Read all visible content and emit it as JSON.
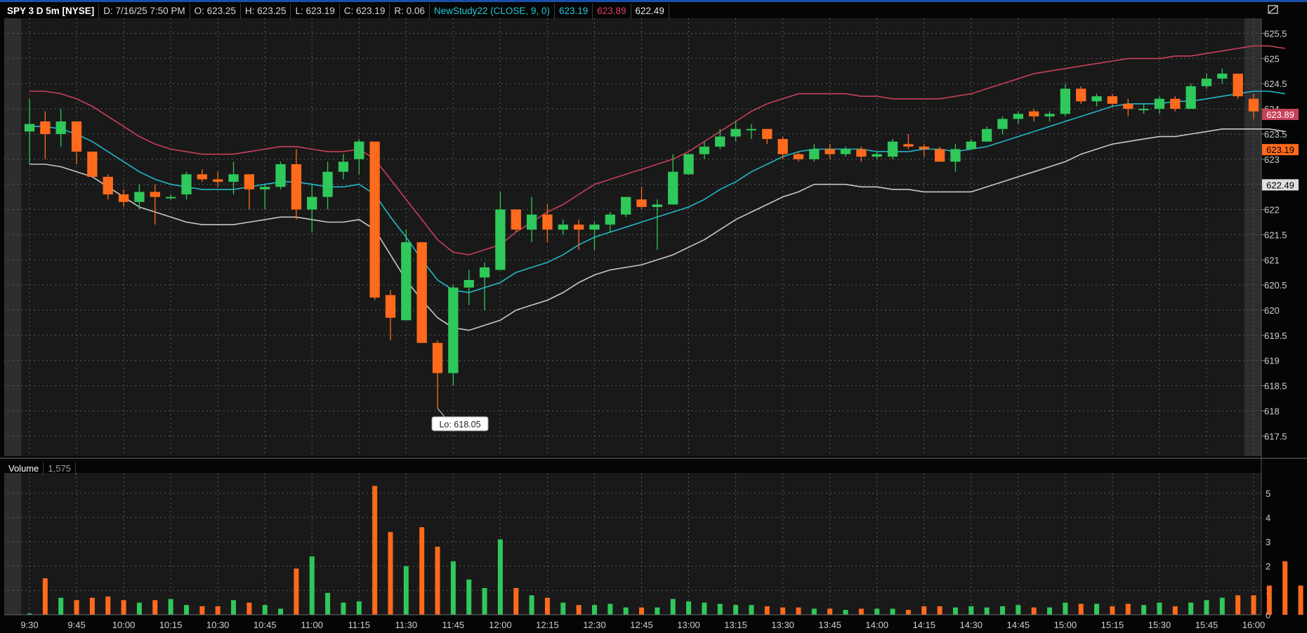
{
  "header": {
    "symbol": "SPY 3 D 5m [NYSE]",
    "date": "D: 7/16/25 7:50 PM",
    "open": "O: 623.25",
    "high": "H: 623.25",
    "low": "L: 623.19",
    "close": "C: 623.19",
    "range": "R: 0.06",
    "study": "NewStudy22 (CLOSE, 9, 0)",
    "study_v1": "623.19",
    "study_v2": "623.89",
    "study_v3": "622.49"
  },
  "volume_header": {
    "label": "Volume",
    "value": "1,575"
  },
  "icons": {
    "restore": "restore-window-icon"
  },
  "colors": {
    "up": "#2fc85a",
    "down": "#ff6a1c",
    "mid_line": "#21b8c8",
    "upper_band": "#c8405a",
    "lower_band": "#c8c8c8",
    "grid": "#5a5a5a",
    "background": "#191919"
  },
  "chart_data": [
    {
      "type": "candlestick",
      "title": "SPY 3 D 5m [NYSE]",
      "ylim": [
        617.1,
        625.8
      ],
      "y_ticks": [
        "617.5",
        "618",
        "618.5",
        "619",
        "619.5",
        "620",
        "620.5",
        "621",
        "621.5",
        "622",
        "622.5",
        "623",
        "623.5",
        "624",
        "624.5",
        "625",
        "625.5"
      ],
      "x_ticks": [
        "9:30",
        "9:45",
        "10:00",
        "10:15",
        "10:30",
        "10:45",
        "11:00",
        "11:15",
        "11:30",
        "11:45",
        "12:00",
        "12:15",
        "12:30",
        "12:45",
        "13:00",
        "13:15",
        "13:30",
        "13:45",
        "14:00",
        "14:15",
        "14:30",
        "14:45",
        "15:00",
        "15:15",
        "15:30",
        "15:45",
        "16:00"
      ],
      "price_labels": {
        "upper": "623.89",
        "last": "623.19",
        "lower": "622.49"
      },
      "annotation": "Lo: 618.05",
      "candles": [
        {
          "t": "9:30",
          "o": 623.55,
          "h": 624.2,
          "l": 622.9,
          "c": 623.7
        },
        {
          "t": "9:35",
          "o": 623.75,
          "h": 623.95,
          "l": 623.0,
          "c": 623.5
        },
        {
          "t": "9:40",
          "o": 623.5,
          "h": 624.0,
          "l": 623.25,
          "c": 623.75
        },
        {
          "t": "9:45",
          "o": 623.75,
          "h": 623.75,
          "l": 622.9,
          "c": 623.15
        },
        {
          "t": "9:50",
          "o": 623.15,
          "h": 623.15,
          "l": 622.65,
          "c": 622.65
        },
        {
          "t": "9:55",
          "o": 622.65,
          "h": 622.7,
          "l": 622.2,
          "c": 622.3
        },
        {
          "t": "10:00",
          "o": 622.3,
          "h": 622.4,
          "l": 622.05,
          "c": 622.15
        },
        {
          "t": "10:05",
          "o": 622.15,
          "h": 622.5,
          "l": 622.0,
          "c": 622.35
        },
        {
          "t": "10:10",
          "o": 622.35,
          "h": 622.5,
          "l": 621.7,
          "c": 622.25
        },
        {
          "t": "10:15",
          "o": 622.25,
          "h": 622.3,
          "l": 622.2,
          "c": 622.25
        },
        {
          "t": "10:20",
          "o": 622.3,
          "h": 622.75,
          "l": 622.2,
          "c": 622.7
        },
        {
          "t": "10:25",
          "o": 622.7,
          "h": 622.8,
          "l": 622.55,
          "c": 622.6
        },
        {
          "t": "10:30",
          "o": 622.6,
          "h": 622.75,
          "l": 622.45,
          "c": 622.55
        },
        {
          "t": "10:35",
          "o": 622.55,
          "h": 622.95,
          "l": 622.3,
          "c": 622.7
        },
        {
          "t": "10:40",
          "o": 622.7,
          "h": 622.7,
          "l": 622.0,
          "c": 622.4
        },
        {
          "t": "10:45",
          "o": 622.4,
          "h": 622.5,
          "l": 622.0,
          "c": 622.45
        },
        {
          "t": "10:50",
          "o": 622.45,
          "h": 622.95,
          "l": 622.4,
          "c": 622.9
        },
        {
          "t": "10:55",
          "o": 622.9,
          "h": 623.2,
          "l": 621.8,
          "c": 622.0
        },
        {
          "t": "11:00",
          "o": 622.0,
          "h": 622.5,
          "l": 621.55,
          "c": 622.25
        },
        {
          "t": "11:05",
          "o": 622.25,
          "h": 622.95,
          "l": 622.0,
          "c": 622.75
        },
        {
          "t": "11:10",
          "o": 622.75,
          "h": 623.1,
          "l": 622.6,
          "c": 622.95
        },
        {
          "t": "11:15",
          "o": 623.0,
          "h": 623.4,
          "l": 622.7,
          "c": 623.35
        },
        {
          "t": "11:20",
          "o": 623.35,
          "h": 623.35,
          "l": 620.2,
          "c": 620.25
        },
        {
          "t": "11:25",
          "o": 620.3,
          "h": 620.4,
          "l": 619.4,
          "c": 619.85
        },
        {
          "t": "11:30",
          "o": 619.8,
          "h": 621.6,
          "l": 619.8,
          "c": 621.35
        },
        {
          "t": "11:35",
          "o": 621.35,
          "h": 621.35,
          "l": 619.35,
          "c": 619.35
        },
        {
          "t": "11:40",
          "o": 619.35,
          "h": 619.4,
          "l": 618.05,
          "c": 618.75
        },
        {
          "t": "11:45",
          "o": 618.75,
          "h": 620.5,
          "l": 618.5,
          "c": 620.45
        },
        {
          "t": "11:50",
          "o": 620.45,
          "h": 620.8,
          "l": 620.1,
          "c": 620.6
        },
        {
          "t": "11:55",
          "o": 620.65,
          "h": 620.95,
          "l": 620.0,
          "c": 620.85
        },
        {
          "t": "12:00",
          "o": 620.8,
          "h": 622.35,
          "l": 620.8,
          "c": 622.0
        },
        {
          "t": "12:05",
          "o": 622.0,
          "h": 622.0,
          "l": 621.55,
          "c": 621.6
        },
        {
          "t": "12:10",
          "o": 621.6,
          "h": 622.25,
          "l": 621.35,
          "c": 621.9
        },
        {
          "t": "12:15",
          "o": 621.9,
          "h": 622.1,
          "l": 621.35,
          "c": 621.6
        },
        {
          "t": "12:20",
          "o": 621.6,
          "h": 621.8,
          "l": 621.5,
          "c": 621.7
        },
        {
          "t": "12:25",
          "o": 621.7,
          "h": 621.8,
          "l": 621.2,
          "c": 621.6
        },
        {
          "t": "12:30",
          "o": 621.6,
          "h": 621.75,
          "l": 621.2,
          "c": 621.7
        },
        {
          "t": "12:35",
          "o": 621.7,
          "h": 621.95,
          "l": 621.55,
          "c": 621.9
        },
        {
          "t": "12:40",
          "o": 621.9,
          "h": 622.25,
          "l": 621.85,
          "c": 622.25
        },
        {
          "t": "12:45",
          "o": 622.2,
          "h": 622.45,
          "l": 622.0,
          "c": 622.05
        },
        {
          "t": "12:50",
          "o": 622.05,
          "h": 622.2,
          "l": 621.2,
          "c": 622.1
        },
        {
          "t": "12:55",
          "o": 622.1,
          "h": 623.1,
          "l": 622.1,
          "c": 622.75
        },
        {
          "t": "13:00",
          "o": 622.7,
          "h": 623.1,
          "l": 622.7,
          "c": 623.1
        },
        {
          "t": "13:05",
          "o": 623.1,
          "h": 623.35,
          "l": 623.0,
          "c": 623.25
        },
        {
          "t": "13:10",
          "o": 623.25,
          "h": 623.6,
          "l": 623.2,
          "c": 623.45
        },
        {
          "t": "13:15",
          "o": 623.45,
          "h": 623.75,
          "l": 623.35,
          "c": 623.6
        },
        {
          "t": "13:20",
          "o": 623.6,
          "h": 623.7,
          "l": 623.4,
          "c": 623.6
        },
        {
          "t": "13:25",
          "o": 623.6,
          "h": 623.6,
          "l": 623.3,
          "c": 623.4
        },
        {
          "t": "13:30",
          "o": 623.4,
          "h": 623.45,
          "l": 623.0,
          "c": 623.1
        },
        {
          "t": "13:35",
          "o": 623.1,
          "h": 623.15,
          "l": 622.95,
          "c": 623.0
        },
        {
          "t": "13:40",
          "o": 623.0,
          "h": 623.3,
          "l": 622.95,
          "c": 623.2
        },
        {
          "t": "13:45",
          "o": 623.2,
          "h": 623.3,
          "l": 623.0,
          "c": 623.1
        },
        {
          "t": "13:50",
          "o": 623.1,
          "h": 623.25,
          "l": 623.05,
          "c": 623.2
        },
        {
          "t": "13:55",
          "o": 623.2,
          "h": 623.25,
          "l": 622.95,
          "c": 623.05
        },
        {
          "t": "14:00",
          "o": 623.05,
          "h": 623.15,
          "l": 623.0,
          "c": 623.1
        },
        {
          "t": "14:05",
          "o": 623.05,
          "h": 623.4,
          "l": 623.0,
          "c": 623.35
        },
        {
          "t": "14:10",
          "o": 623.3,
          "h": 623.5,
          "l": 623.2,
          "c": 623.25
        },
        {
          "t": "14:15",
          "o": 623.25,
          "h": 623.3,
          "l": 623.05,
          "c": 623.2
        },
        {
          "t": "14:20",
          "o": 623.2,
          "h": 623.25,
          "l": 622.95,
          "c": 622.95
        },
        {
          "t": "14:25",
          "o": 622.95,
          "h": 623.3,
          "l": 622.75,
          "c": 623.2
        },
        {
          "t": "14:30",
          "o": 623.2,
          "h": 623.4,
          "l": 623.2,
          "c": 623.35
        },
        {
          "t": "14:35",
          "o": 623.35,
          "h": 623.65,
          "l": 623.35,
          "c": 623.6
        },
        {
          "t": "14:40",
          "o": 623.6,
          "h": 623.85,
          "l": 623.5,
          "c": 623.8
        },
        {
          "t": "14:45",
          "o": 623.8,
          "h": 623.95,
          "l": 623.7,
          "c": 623.9
        },
        {
          "t": "14:50",
          "o": 623.95,
          "h": 624.0,
          "l": 623.75,
          "c": 623.85
        },
        {
          "t": "14:55",
          "o": 623.85,
          "h": 623.95,
          "l": 623.75,
          "c": 623.9
        },
        {
          "t": "15:00",
          "o": 623.9,
          "h": 624.5,
          "l": 623.85,
          "c": 624.4
        },
        {
          "t": "15:05",
          "o": 624.4,
          "h": 624.45,
          "l": 624.1,
          "c": 624.15
        },
        {
          "t": "15:10",
          "o": 624.15,
          "h": 624.3,
          "l": 624.05,
          "c": 624.25
        },
        {
          "t": "15:15",
          "o": 624.25,
          "h": 624.3,
          "l": 624.05,
          "c": 624.1
        },
        {
          "t": "15:20",
          "o": 624.1,
          "h": 624.2,
          "l": 623.85,
          "c": 624.0
        },
        {
          "t": "15:25",
          "o": 624.0,
          "h": 624.1,
          "l": 623.9,
          "c": 624.0
        },
        {
          "t": "15:30",
          "o": 624.0,
          "h": 624.25,
          "l": 623.9,
          "c": 624.2
        },
        {
          "t": "15:35",
          "o": 624.2,
          "h": 624.25,
          "l": 623.95,
          "c": 624.0
        },
        {
          "t": "15:40",
          "o": 624.0,
          "h": 624.5,
          "l": 624.0,
          "c": 624.45
        },
        {
          "t": "15:45",
          "o": 624.45,
          "h": 624.7,
          "l": 624.4,
          "c": 624.6
        },
        {
          "t": "15:50",
          "o": 624.6,
          "h": 624.8,
          "l": 624.5,
          "c": 624.7
        },
        {
          "t": "15:55",
          "o": 624.7,
          "h": 624.7,
          "l": 624.2,
          "c": 624.25
        },
        {
          "t": "16:00",
          "o": 624.2,
          "h": 624.3,
          "l": 623.8,
          "c": 623.95
        }
      ],
      "series": [
        {
          "values": [
            623.65,
            623.65,
            623.6,
            623.5,
            623.35,
            623.15,
            622.95,
            622.75,
            622.6,
            622.5,
            622.45,
            622.4,
            622.4,
            622.4,
            622.45,
            622.5,
            622.55,
            622.55,
            622.5,
            622.45,
            622.45,
            622.5,
            622.3,
            621.85,
            621.45,
            621.0,
            620.6,
            620.4,
            620.35,
            620.45,
            620.55,
            620.75,
            620.85,
            620.95,
            621.1,
            621.3,
            621.45,
            621.55,
            621.65,
            621.75,
            621.85,
            621.95,
            622.05,
            622.2,
            622.4,
            622.55,
            622.75,
            622.9,
            623.05,
            623.15,
            623.2,
            623.2,
            623.2,
            623.2,
            623.15,
            623.15,
            623.15,
            623.2,
            623.2,
            623.15,
            623.2,
            623.25,
            623.35,
            623.45,
            623.55,
            623.65,
            623.75,
            623.85,
            623.95,
            624.05,
            624.1,
            624.1,
            624.1,
            624.15,
            624.15,
            624.2,
            624.25,
            624.3,
            624.35,
            624.35,
            624.3
          ]
        },
        {
          "values": [
            624.35,
            624.35,
            624.3,
            624.2,
            624.05,
            623.85,
            623.65,
            623.45,
            623.3,
            623.2,
            623.15,
            623.1,
            623.1,
            623.1,
            623.15,
            623.2,
            623.25,
            623.25,
            623.2,
            623.15,
            623.15,
            623.2,
            623.0,
            622.6,
            622.2,
            621.8,
            621.4,
            621.15,
            621.1,
            621.2,
            621.3,
            621.55,
            621.75,
            621.95,
            622.1,
            622.3,
            622.5,
            622.6,
            622.7,
            622.8,
            622.9,
            623.0,
            623.15,
            623.35,
            623.55,
            623.75,
            623.95,
            624.1,
            624.2,
            624.3,
            624.3,
            624.3,
            624.3,
            624.25,
            624.25,
            624.2,
            624.2,
            624.2,
            624.2,
            624.25,
            624.3,
            624.4,
            624.5,
            624.6,
            624.7,
            624.75,
            624.8,
            624.85,
            624.9,
            624.95,
            625.0,
            625.0,
            625.0,
            625.05,
            625.05,
            625.1,
            625.15,
            625.2,
            625.25,
            625.25,
            625.2
          ]
        },
        {
          "values": [
            622.9,
            622.9,
            622.85,
            622.75,
            622.65,
            622.45,
            622.25,
            622.05,
            621.95,
            621.85,
            621.75,
            621.7,
            621.7,
            621.7,
            621.75,
            621.8,
            621.85,
            621.85,
            621.8,
            621.75,
            621.75,
            621.8,
            621.6,
            621.1,
            620.6,
            620.2,
            619.85,
            619.65,
            619.6,
            619.7,
            619.8,
            620.0,
            620.1,
            620.2,
            620.35,
            620.55,
            620.7,
            620.8,
            620.85,
            620.9,
            621.0,
            621.1,
            621.25,
            621.4,
            621.6,
            621.8,
            621.95,
            622.1,
            622.25,
            622.35,
            622.5,
            622.5,
            622.5,
            622.45,
            622.45,
            622.4,
            622.4,
            622.35,
            622.35,
            622.35,
            622.35,
            622.45,
            622.55,
            622.65,
            622.75,
            622.85,
            622.95,
            623.1,
            623.2,
            623.3,
            623.35,
            623.4,
            623.45,
            623.45,
            623.5,
            623.55,
            623.6,
            623.6,
            623.6,
            623.6,
            623.55
          ]
        }
      ]
    },
    {
      "type": "bar",
      "title": "Volume",
      "ylim": [
        0,
        5.6
      ],
      "y_ticks": [
        "0",
        "1",
        "2",
        "3",
        "4",
        "5"
      ],
      "values": [
        0.05,
        1.5,
        0.7,
        0.6,
        0.7,
        0.75,
        0.6,
        0.5,
        0.6,
        0.65,
        0.4,
        0.35,
        0.35,
        0.6,
        0.5,
        0.4,
        0.25,
        1.9,
        2.4,
        0.9,
        0.5,
        0.55,
        5.3,
        3.4,
        2.0,
        3.6,
        2.8,
        2.2,
        1.45,
        1.1,
        3.1,
        1.1,
        0.8,
        0.7,
        0.5,
        0.4,
        0.4,
        0.45,
        0.3,
        0.3,
        0.3,
        0.65,
        0.55,
        0.5,
        0.45,
        0.4,
        0.4,
        0.35,
        0.3,
        0.3,
        0.25,
        0.25,
        0.2,
        0.25,
        0.25,
        0.25,
        0.2,
        0.35,
        0.35,
        0.3,
        0.35,
        0.3,
        0.35,
        0.4,
        0.3,
        0.3,
        0.5,
        0.45,
        0.45,
        0.35,
        0.45,
        0.4,
        0.5,
        0.35,
        0.5,
        0.6,
        0.7,
        0.8,
        0.8,
        1.2,
        2.2,
        1.2
      ]
    }
  ]
}
